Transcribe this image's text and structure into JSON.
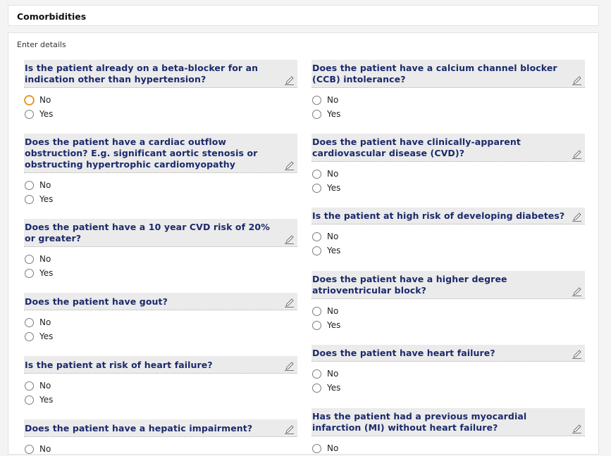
{
  "section": {
    "title": "Comorbidities",
    "subtitle": "Enter details"
  },
  "options": {
    "no": "No",
    "yes": "Yes"
  },
  "left_questions": [
    {
      "text": "Is the patient already on a beta-blocker for an indication other than hypertension?"
    },
    {
      "text": "Does the patient have a cardiac outflow obstruction? E.g. significant aortic stenosis or obstructing hypertrophic cardiomyopathy"
    },
    {
      "text": "Does the patient have a 10 year CVD risk of 20% or greater?"
    },
    {
      "text": "Does the patient have gout?"
    },
    {
      "text": "Is the patient at risk of heart failure?"
    },
    {
      "text": "Does the patient have a hepatic impairment?"
    }
  ],
  "right_questions": [
    {
      "text": "Does the patient have a calcium channel blocker (CCB) intolerance?"
    },
    {
      "text": "Does the patient have clinically-apparent cardiovascular disease (CVD)?"
    },
    {
      "text": "Is the patient at high risk of developing diabetes?"
    },
    {
      "text": "Does the patient have a higher degree atrioventricular block?"
    },
    {
      "text": "Does the patient have heart failure?"
    },
    {
      "text": "Has the patient had a previous myocardial infarction (MI) without heart failure?"
    }
  ],
  "icons": {
    "edit": "edit-pencil-icon"
  },
  "colors": {
    "question_text": "#1b2a6b",
    "question_bg": "#ebebeb",
    "focus_ring": "#f0b040"
  }
}
